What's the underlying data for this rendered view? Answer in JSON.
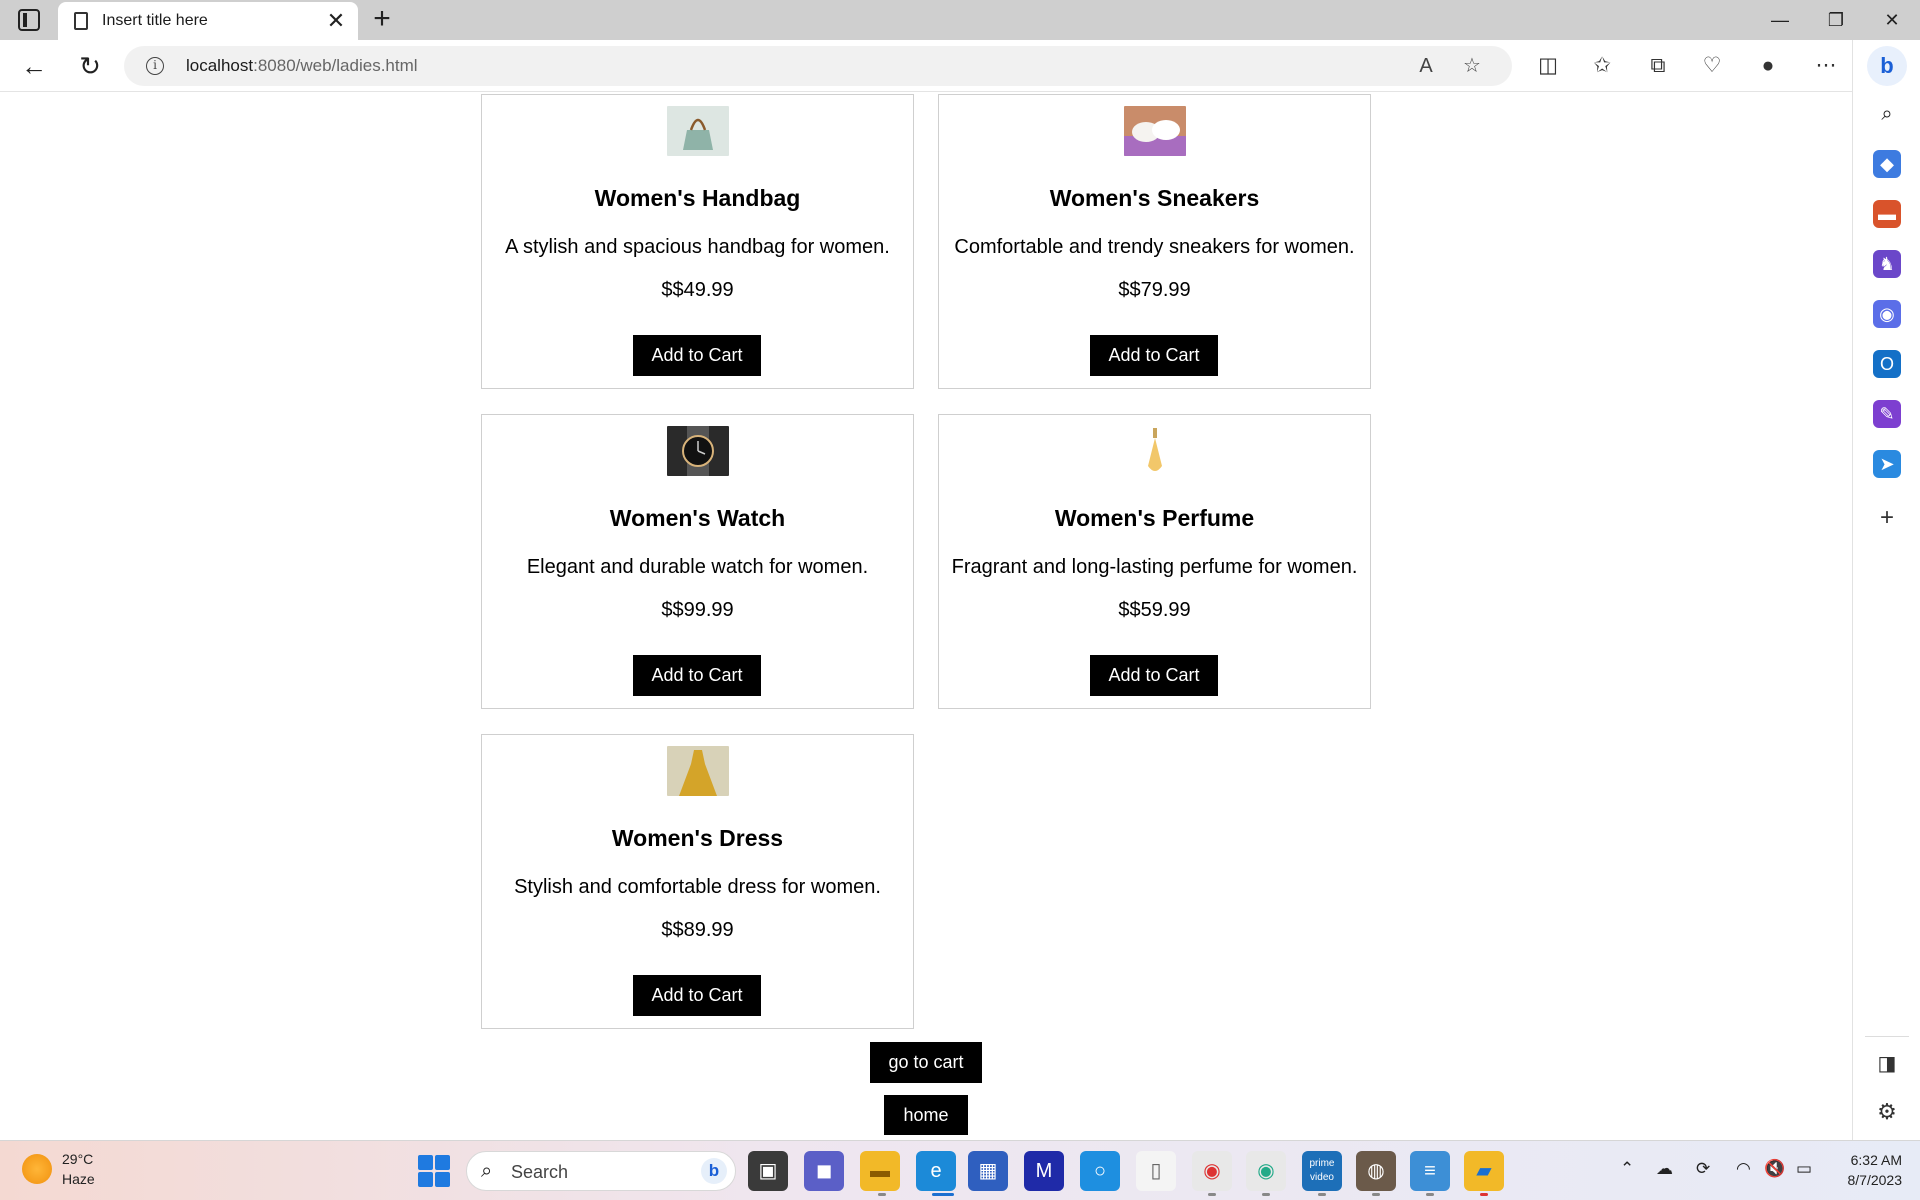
{
  "browser": {
    "tab_title": "Insert title here",
    "url_host": "localhost",
    "url_rest": ":8080/web/ladies.html"
  },
  "products": [
    {
      "name": "Women's Handbag",
      "description": "A stylish and spacious handbag for women.",
      "price": "$$49.99",
      "button": "Add to Cart",
      "image": "handbag-image"
    },
    {
      "name": "Women's Sneakers",
      "description": "Comfortable and trendy sneakers for women.",
      "price": "$$79.99",
      "button": "Add to Cart",
      "image": "sneakers-image"
    },
    {
      "name": "Women's Watch",
      "description": "Elegant and durable watch for women.",
      "price": "$$99.99",
      "button": "Add to Cart",
      "image": "watch-image"
    },
    {
      "name": "Women's Perfume",
      "description": "Fragrant and long-lasting perfume for women.",
      "price": "$$59.99",
      "button": "Add to Cart",
      "image": "perfume-image"
    },
    {
      "name": "Women's Dress",
      "description": "Stylish and comfortable dress for women.",
      "price": "$$89.99",
      "button": "Add to Cart",
      "image": "dress-image"
    }
  ],
  "footer": {
    "go_to_cart": "go to cart",
    "home": "home"
  },
  "taskbar": {
    "temperature": "29°C",
    "condition": "Haze",
    "search_placeholder": "Search",
    "time": "6:32 AM",
    "date": "8/7/2023"
  }
}
